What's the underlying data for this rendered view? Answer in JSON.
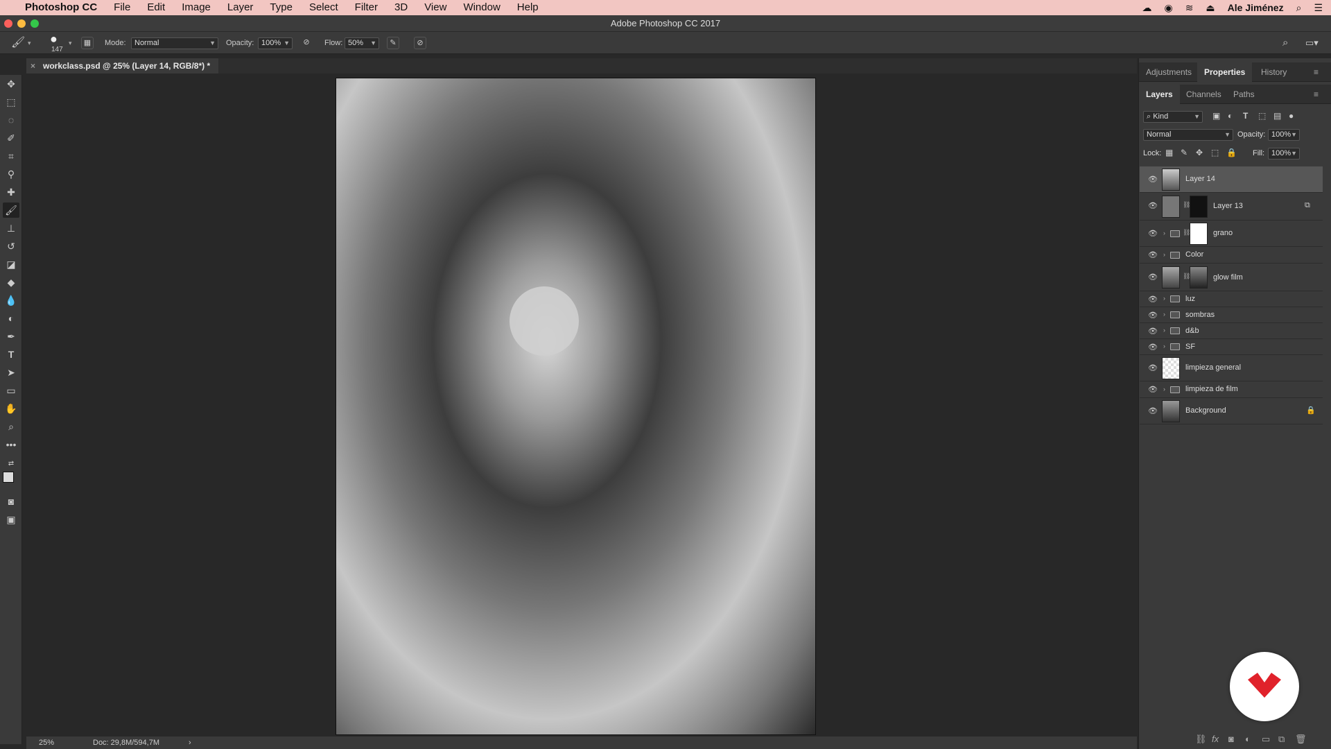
{
  "menubar": {
    "apple_icon": "apple-icon",
    "app": "Photoshop CC",
    "items": [
      "File",
      "Edit",
      "Image",
      "Layer",
      "Type",
      "Select",
      "Filter",
      "3D",
      "View",
      "Window",
      "Help"
    ],
    "user": "Ale Jiménez"
  },
  "window": {
    "title": "Adobe Photoshop CC 2017"
  },
  "options": {
    "brush_size": "147",
    "mode_label": "Mode:",
    "mode_value": "Normal",
    "opacity_label": "Opacity:",
    "opacity_value": "100%",
    "flow_label": "Flow:",
    "flow_value": "50%"
  },
  "document": {
    "tab_title": "workclass.psd @ 25% (Layer 14, RGB/8*) *",
    "zoom": "25%",
    "doc_info": "Doc: 29,8M/594,7M"
  },
  "panels": {
    "top_tabs": [
      "Adjustments",
      "Properties",
      "History"
    ],
    "layer_tabs": [
      "Layers",
      "Channels",
      "Paths"
    ],
    "kind": "Kind",
    "blend": "Normal",
    "opacity_label": "Opacity:",
    "opacity": "100%",
    "lock_label": "Lock:",
    "fill_label": "Fill:",
    "fill": "100%"
  },
  "layers": [
    {
      "name": "Layer 14",
      "type": "pixel",
      "selected": true
    },
    {
      "name": "Layer 13",
      "type": "masked"
    },
    {
      "name": "grano",
      "type": "group-mask"
    },
    {
      "name": "Color",
      "type": "group"
    },
    {
      "name": "glow film",
      "type": "masked"
    },
    {
      "name": "luz",
      "type": "group"
    },
    {
      "name": "sombras",
      "type": "group"
    },
    {
      "name": "d&b",
      "type": "group"
    },
    {
      "name": "SF",
      "type": "group"
    },
    {
      "name": "limpieza general",
      "type": "pixel"
    },
    {
      "name": "limpieza de film",
      "type": "group"
    },
    {
      "name": "Background",
      "type": "locked"
    }
  ],
  "colors": {
    "menubar": "#f2c6c2",
    "panel": "#3a3a3a",
    "canvas": "#282828",
    "badge_red": "#e0222b"
  }
}
